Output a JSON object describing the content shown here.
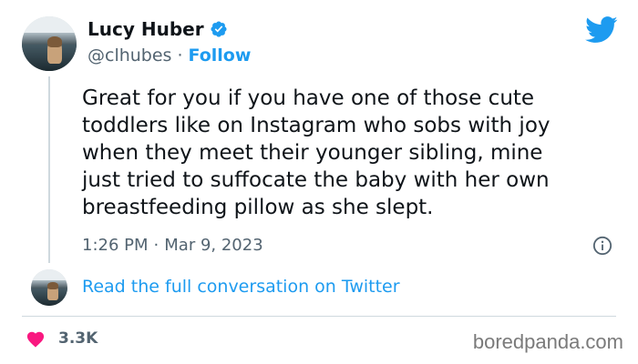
{
  "author": {
    "name": "Lucy Huber",
    "handle": "@clhubes",
    "separator": "·",
    "follow_label": "Follow"
  },
  "tweet": {
    "text": "Great for you if you have one of those cute\ntoddlers like on Instagram who sobs with joy\nwhen they meet their younger sibling, mine\njust tried to suffocate the baby with her own\nbreastfeeding pillow as she slept.",
    "time": "1:26 PM",
    "meta_separator": "·",
    "date": "Mar 9, 2023"
  },
  "conversation_link": "Read the full conversation on Twitter",
  "likes": {
    "count": "3.3K"
  },
  "watermark": "boredpanda.com",
  "colors": {
    "brand_blue": "#1d9bf0",
    "heart_pink": "#f91880",
    "muted_text": "#536471"
  },
  "icons": {
    "verified": "verified-badge-icon",
    "bird": "twitter-bird-icon",
    "info": "info-icon",
    "heart": "heart-icon"
  }
}
